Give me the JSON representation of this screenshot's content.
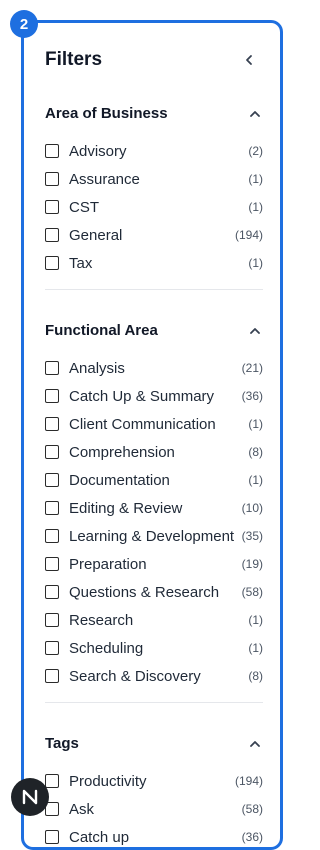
{
  "step_badge": "2",
  "header": {
    "title": "Filters",
    "collapse_icon": "chevron-left-icon"
  },
  "sections": [
    {
      "title": "Area of Business",
      "icon": "chevron-up-icon",
      "items": [
        {
          "label": "Advisory",
          "count": "(2)"
        },
        {
          "label": "Assurance",
          "count": "(1)"
        },
        {
          "label": "CST",
          "count": "(1)"
        },
        {
          "label": "General",
          "count": "(194)"
        },
        {
          "label": "Tax",
          "count": "(1)"
        }
      ]
    },
    {
      "title": "Functional Area",
      "icon": "chevron-up-icon",
      "items": [
        {
          "label": "Analysis",
          "count": "(21)"
        },
        {
          "label": "Catch Up & Summary",
          "count": "(36)"
        },
        {
          "label": "Client Communication",
          "count": "(1)"
        },
        {
          "label": "Comprehension",
          "count": "(8)"
        },
        {
          "label": "Documentation",
          "count": "(1)"
        },
        {
          "label": "Editing & Review",
          "count": "(10)"
        },
        {
          "label": "Learning & Development",
          "count": "(35)"
        },
        {
          "label": "Preparation",
          "count": "(19)"
        },
        {
          "label": "Questions & Research",
          "count": "(58)"
        },
        {
          "label": "Research",
          "count": "(1)"
        },
        {
          "label": "Scheduling",
          "count": "(1)"
        },
        {
          "label": "Search & Discovery",
          "count": "(8)"
        }
      ]
    },
    {
      "title": "Tags",
      "icon": "chevron-up-icon",
      "items": [
        {
          "label": "Productivity",
          "count": "(194)"
        },
        {
          "label": "Ask",
          "count": "(58)"
        },
        {
          "label": "Catch up",
          "count": "(36)"
        }
      ]
    }
  ],
  "brand_logo": "N",
  "colors": {
    "accent": "#1e6fe0",
    "brand_bg": "#1f2328"
  }
}
